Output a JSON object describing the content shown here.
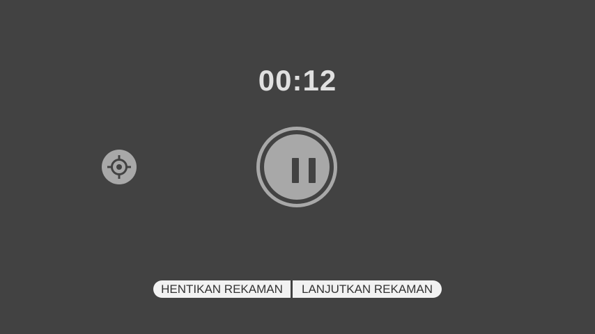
{
  "recorder": {
    "elapsed_time": "00:12",
    "state": "paused"
  },
  "controls": {
    "pause_icon": "pause-icon",
    "locate_icon": "crosshair-icon"
  },
  "actions": {
    "stop_label": "HENTIKAN REKAMAN",
    "resume_label": "LANJUTKAN REKAMAN"
  },
  "colors": {
    "background": "#424242",
    "control": "#a8a8a8",
    "timer_text": "#e0e0e0",
    "action_bg": "#f2f2f2",
    "action_text": "#333333"
  }
}
